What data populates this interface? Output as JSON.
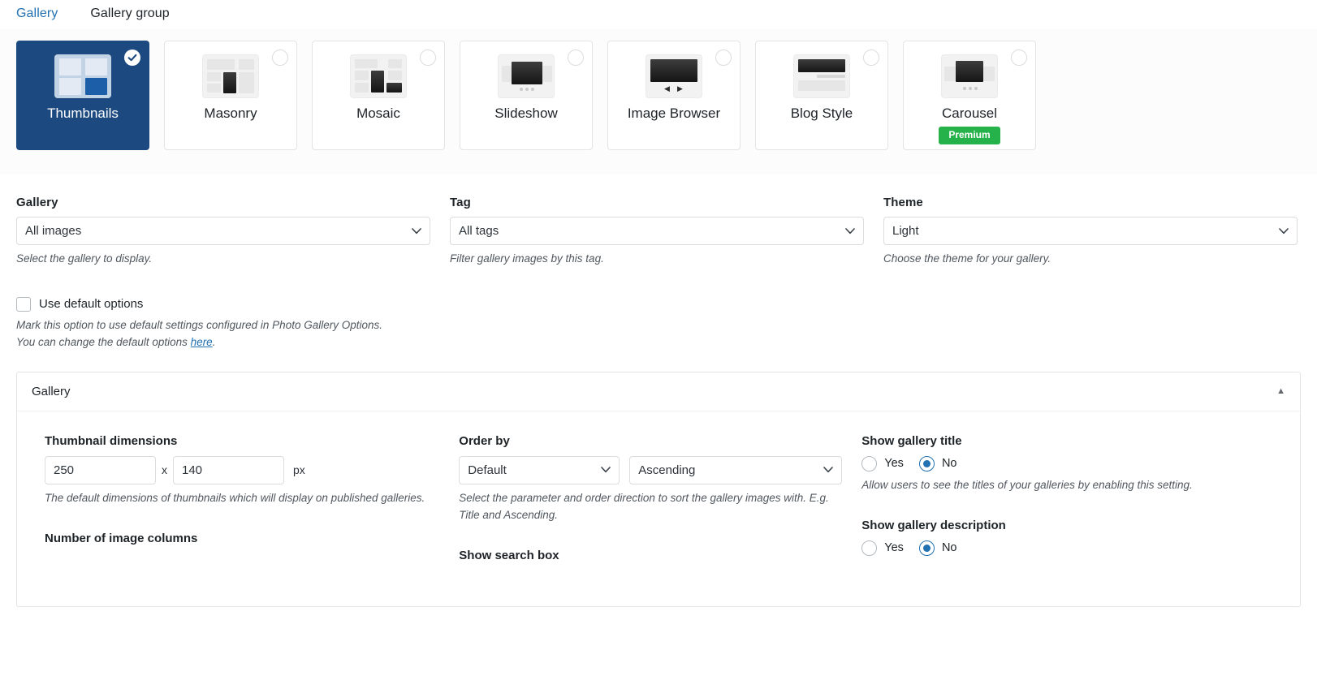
{
  "tabs": [
    {
      "label": "Gallery",
      "active": true
    },
    {
      "label": "Gallery group",
      "active": false
    }
  ],
  "gallery_types": [
    {
      "label": "Thumbnails",
      "selected": true,
      "premium": null
    },
    {
      "label": "Masonry",
      "selected": false,
      "premium": null
    },
    {
      "label": "Mosaic",
      "selected": false,
      "premium": null
    },
    {
      "label": "Slideshow",
      "selected": false,
      "premium": null
    },
    {
      "label": "Image Browser",
      "selected": false,
      "premium": null
    },
    {
      "label": "Blog Style",
      "selected": false,
      "premium": null
    },
    {
      "label": "Carousel",
      "selected": false,
      "premium": "Premium"
    }
  ],
  "fields": {
    "gallery": {
      "label": "Gallery",
      "value": "All images",
      "hint": "Select the gallery to display."
    },
    "tag": {
      "label": "Tag",
      "value": "All tags",
      "hint": "Filter gallery images by this tag."
    },
    "theme": {
      "label": "Theme",
      "value": "Light",
      "hint": "Choose the theme for your gallery."
    }
  },
  "default_options": {
    "label": "Use default options",
    "checked": false,
    "hint_line1": "Mark this option to use default settings configured in Photo Gallery Options.",
    "hint_line2_before": "You can change the default options ",
    "hint_link": "here",
    "hint_line2_after": "."
  },
  "panel": {
    "title": "Gallery",
    "collapse_caret": "▲",
    "thumbnail_dimensions": {
      "label": "Thumbnail dimensions",
      "width": "250",
      "separator": "x",
      "height": "140",
      "unit": "px",
      "hint": "The default dimensions of thumbnails which will display on published galleries."
    },
    "order_by": {
      "label": "Order by",
      "parameter": "Default",
      "direction": "Ascending",
      "hint": "Select the parameter and order direction to sort the gallery images with. E.g. Title and Ascending."
    },
    "show_gallery_title": {
      "label": "Show gallery title",
      "yes_label": "Yes",
      "no_label": "No",
      "selected": "No",
      "hint": "Allow users to see the titles of your galleries by enabling this setting."
    },
    "show_gallery_description": {
      "label": "Show gallery description",
      "yes_label": "Yes",
      "no_label": "No",
      "selected": "No"
    },
    "number_of_image_columns": {
      "label": "Number of image columns"
    },
    "show_search_box": {
      "label": "Show search box"
    }
  },
  "colors": {
    "accent": "#2271b1",
    "selected_card": "#1c4a80",
    "premium_badge": "#26b24b",
    "border": "#dcdcde"
  }
}
